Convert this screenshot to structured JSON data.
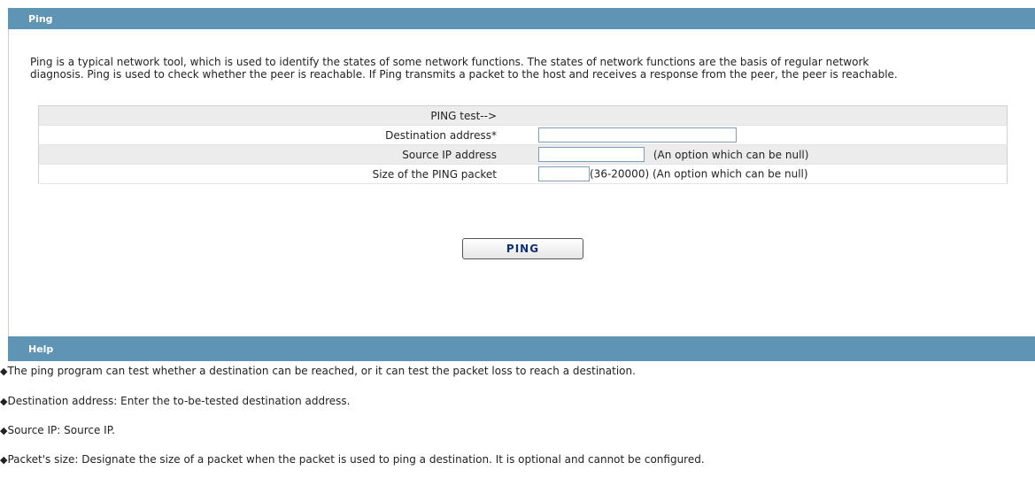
{
  "ping_panel": {
    "title": "Ping",
    "description_line1": "Ping is a typical network tool, which is used to identify the states of some network functions. The states of network functions are the basis of regular network",
    "description_line2": "diagnosis. Ping is used to check whether the peer is reachable. If Ping transmits a packet to the host and receives a response from the peer, the peer is reachable."
  },
  "form": {
    "header": "PING test-->",
    "destination_label": "Destination address*",
    "destination_value": "",
    "source_label": "Source IP address",
    "source_value": "",
    "source_hint": "(An option which can be null)",
    "size_label": "Size of the PING packet",
    "size_value": "",
    "size_hint": "(36-20000) (An option which can be null)"
  },
  "ping_button_label": "PING",
  "help_panel": {
    "title": "Help",
    "bullet": "◆",
    "lines": [
      "The ping program can test whether a destination can be reached, or it can test the packet loss to reach a destination.",
      "Destination address: Enter the to-be-tested destination address.",
      "Source IP: Source IP.",
      "Packet's size: Designate the size of a packet when the packet is used to ping a destination. It is optional and cannot be configured."
    ]
  }
}
